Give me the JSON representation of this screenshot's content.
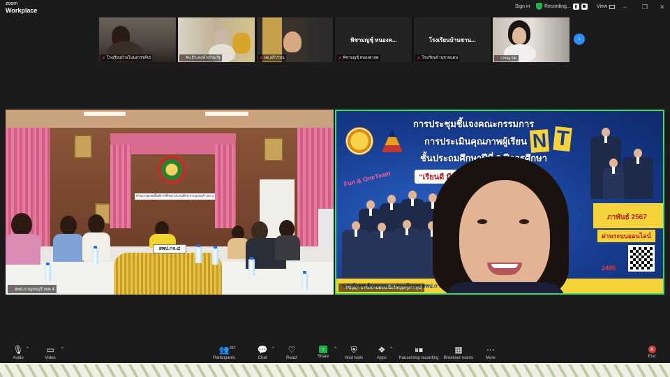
{
  "app": {
    "brand_line1": "zoom",
    "brand_line2": "Workplace"
  },
  "topbar": {
    "sign_in": "Sign in",
    "recording_label": "Recording...",
    "view_label": "View",
    "window_controls": [
      "–",
      "❐",
      "✕"
    ]
  },
  "strip": {
    "tiles": [
      {
        "name": "โรงเรียนบ้านโนนสวรรค์15",
        "big": ""
      },
      {
        "name": "ศน.ธีระพงษ์ พรรณรัฐ",
        "big": ""
      },
      {
        "name": "ผอ.อภิวรรณ",
        "big": ""
      },
      {
        "name": "พิชามญชุ์ หนองตาลต",
        "big": "พิชามญชุ์ หนองค..."
      },
      {
        "name": "โรงเรียนบ้านชายแดน",
        "big": "โรงเรียนบ้านชาน..."
      },
      {
        "name": "Chuty NK",
        "big": ""
      }
    ],
    "next_icon": "›"
  },
  "main": {
    "left": {
      "name": "สพป.กาญจนบุรี เขต 4",
      "sign_text": "สำนักงานเขตพื้นที่การศึกษาประถมศึกษากาญจนบุรี เขต ๔",
      "nameplate": "สพป.กจ.๔"
    },
    "right": {
      "name": "จิรัญญา ธรรมบ้านดอนเนื้อใหญ่(ครูสาวจูน)",
      "slide": {
        "title1": "การประชุมชี้แจงคณะกรรมการ",
        "title2": "การประเมินคุณภาพผู้เรียน",
        "title3": "ชั้นประถมศึกษาปีที่ 3 ปีการศึกษา",
        "nt_n": "N",
        "nt_t": "T",
        "motto": "“เรียนดี มีความสุข”",
        "fun": "Fun & OneTeam",
        "date": "ภาพันธ์ 2567",
        "online": "ผ่านระบบออนไลน์",
        "number": "2495",
        "bottom": "กลุ่มนิเทศ ติดตามและประเมินผล สพป.กาญจนบุรี เขต 4"
      }
    }
  },
  "toolbar": {
    "audio": "Audio",
    "video": "Video",
    "participants": "Participants",
    "participants_count": "267",
    "chat": "Chat",
    "react": "React",
    "share": "Share",
    "host_tools": "Host tools",
    "apps": "Apps",
    "pause_stop": "Pause/stop recording",
    "breakout": "Breakout rooms",
    "more": "More",
    "end": "End"
  }
}
